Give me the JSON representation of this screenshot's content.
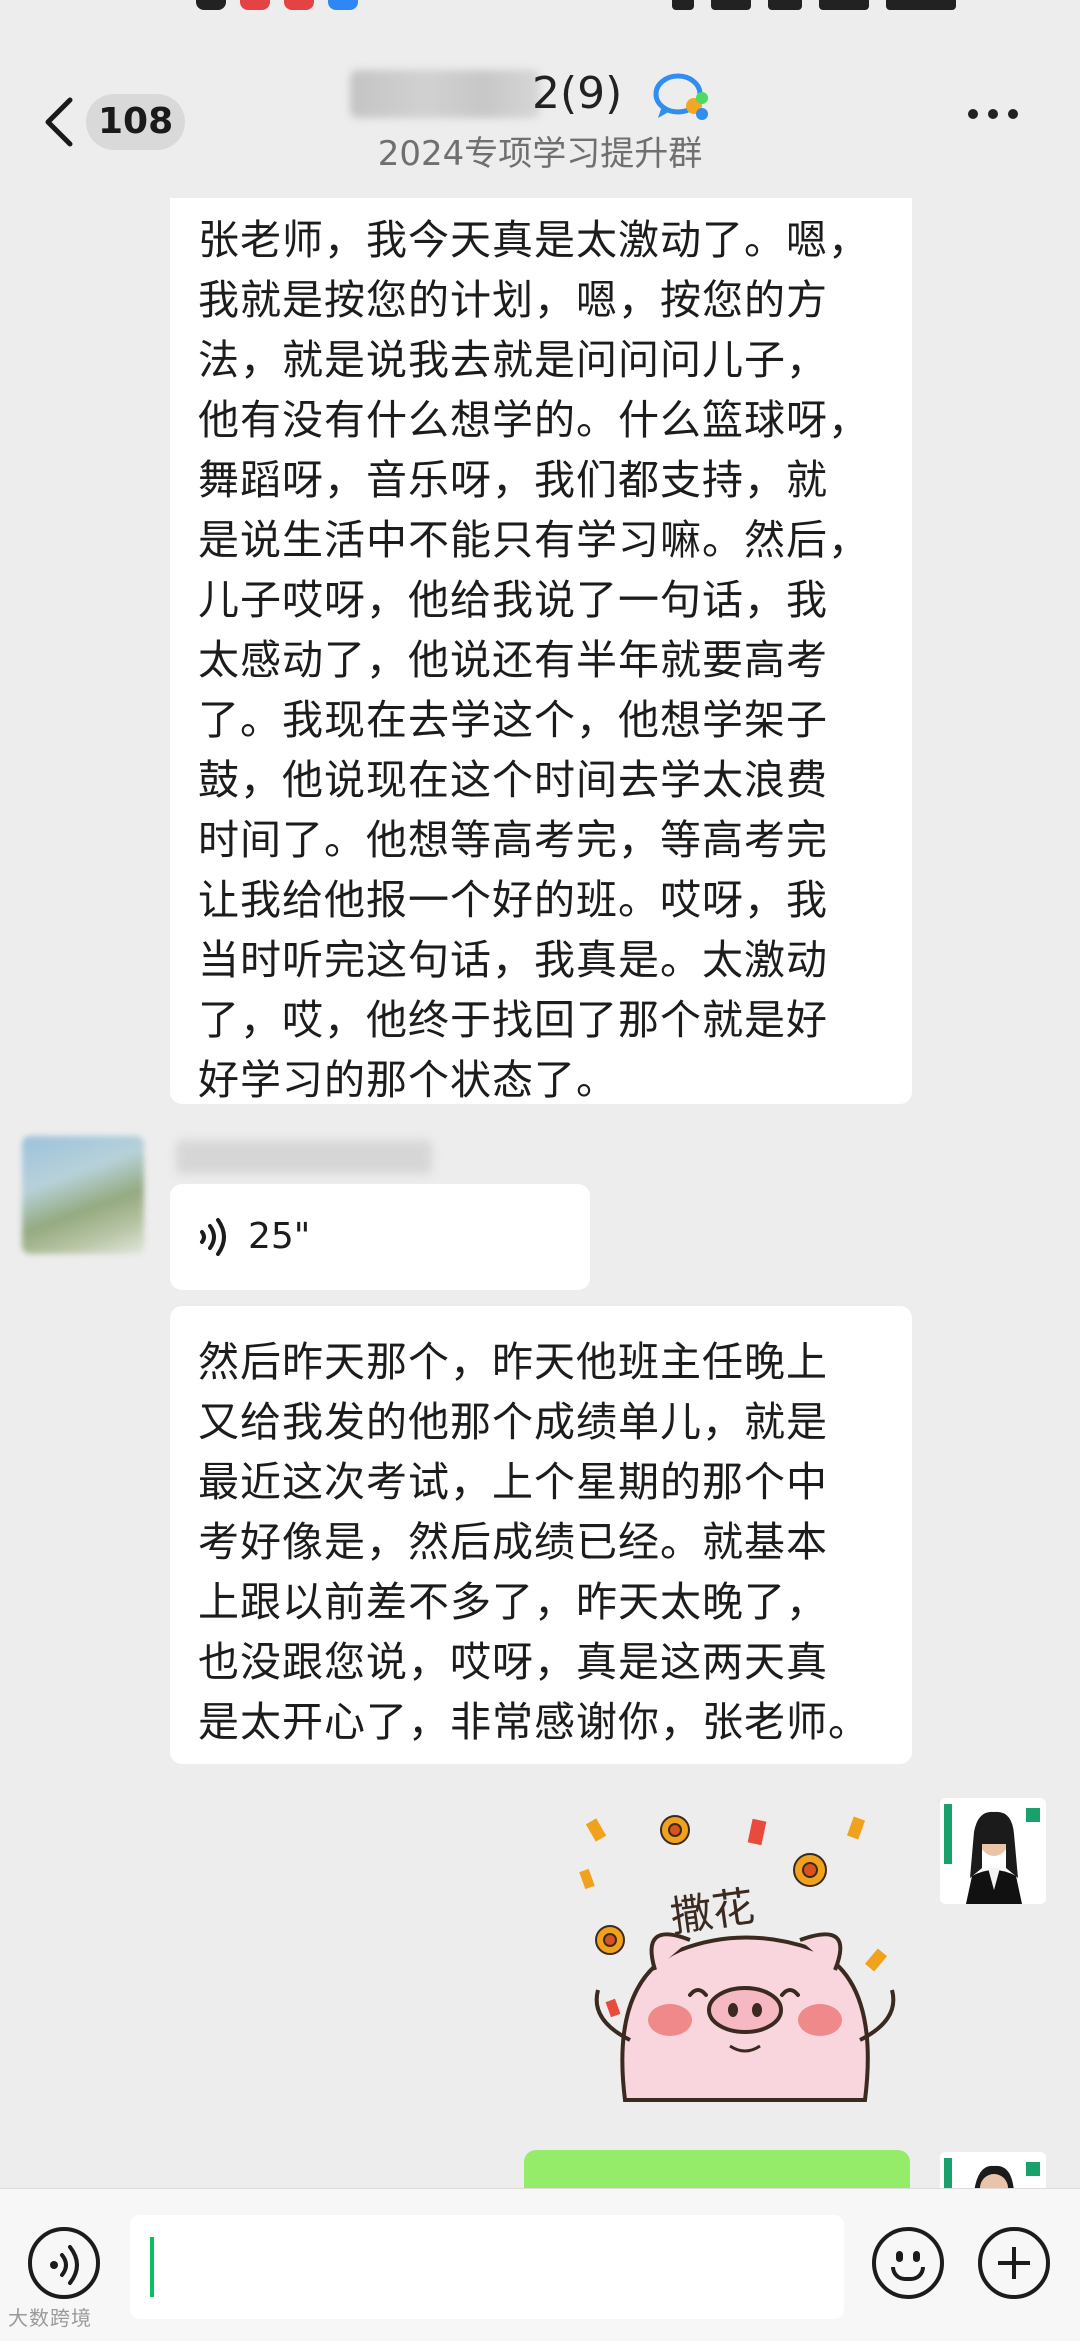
{
  "header": {
    "unread_count": "108",
    "title_suffix": "2(9)",
    "subtitle": "2024专项学习提升群"
  },
  "messages": [
    {
      "text": "张老师，我今天真是太激动了。嗯，\n我就是按您的计划，嗯，按您的方\n法，就是说我去就是问问问儿子，\n他有没有什么想学的。什么篮球呀，\n舞蹈呀，音乐呀，我们都支持，就\n是说生活中不能只有学习嘛。然后，\n儿子哎呀，他给我说了一句话，我\n太感动了，他说还有半年就要高考\n了。我现在去学这个，他想学架子\n鼓，他说现在这个时间去学太浪费\n时间了。他想等高考完，等高考完\n让我给他报一个好的班。哎呀，我\n当时听完这句话，我真是。太激动\n了，哎，他终于找回了那个就是好\n好学习的那个状态了。"
    },
    {
      "voice_duration": "25\""
    },
    {
      "text": "然后昨天那个，昨天他班主任晚上\n又给我发的他那个成绩单儿，就是\n最近这次考试，上个星期的那个中\n考好像是，然后成绩已经。就基本\n上跟以前差不多了，昨天太晚了，\n也没跟您说，哎呀，真是这两天真\n是太开心了，非常感谢你，张老师。"
    }
  ],
  "sticker": {
    "text": "撒花"
  },
  "input": {
    "value": ""
  },
  "watermark": "大数跨境",
  "colors": {
    "background": "#ededed",
    "bubble_other": "#ffffff",
    "bubble_self": "#95ec69",
    "accent": "#07c160"
  }
}
